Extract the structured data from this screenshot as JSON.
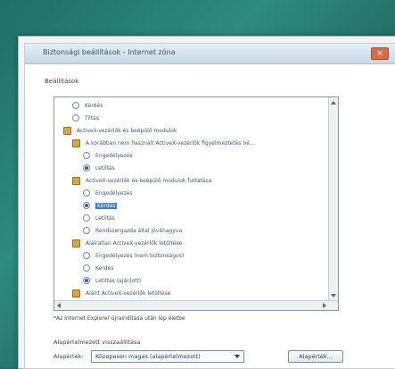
{
  "window": {
    "title": "Biztonsági beállítások - Internet zóna",
    "close_label": "×"
  },
  "settings_label": "Beállítások",
  "items": [
    {
      "type": "radio",
      "level": 2,
      "checked": false,
      "selected": false,
      "label": "Kérdés"
    },
    {
      "type": "radio",
      "level": 2,
      "checked": false,
      "selected": false,
      "label": "Tiltás"
    },
    {
      "type": "group",
      "level": 1,
      "label": "ActiveX-vezérlők és beépülő modulok"
    },
    {
      "type": "group",
      "level": 2,
      "label": "A korábban nem használt ActiveX-vezérlők figyelmeztetés né..."
    },
    {
      "type": "radio",
      "level": 3,
      "checked": false,
      "selected": false,
      "label": "Engedélyezés"
    },
    {
      "type": "radio",
      "level": 3,
      "checked": true,
      "selected": false,
      "label": "Letiltás"
    },
    {
      "type": "group",
      "level": 2,
      "label": "ActiveX-vezérlők és beépülő modulok futtatása"
    },
    {
      "type": "radio",
      "level": 3,
      "checked": false,
      "selected": false,
      "label": "Engedélyezés"
    },
    {
      "type": "radio",
      "level": 3,
      "checked": true,
      "selected": true,
      "label": "Kérdés"
    },
    {
      "type": "radio",
      "level": 3,
      "checked": false,
      "selected": false,
      "label": "Letiltás"
    },
    {
      "type": "radio",
      "level": 3,
      "checked": false,
      "selected": false,
      "label": "Rendszergazda által jóváhagyva"
    },
    {
      "type": "group",
      "level": 2,
      "label": "Aláíratlan ActiveX-vezérlők letöltése"
    },
    {
      "type": "radio",
      "level": 3,
      "checked": false,
      "selected": false,
      "label": "Engedélyezés (nem biztonságos)"
    },
    {
      "type": "radio",
      "level": 3,
      "checked": false,
      "selected": false,
      "label": "Kérdés"
    },
    {
      "type": "radio",
      "level": 3,
      "checked": true,
      "selected": false,
      "label": "Letiltás (ajánlott)"
    },
    {
      "type": "group",
      "level": 2,
      "label": "Aláírt ActiveX-vezérlők letöltése"
    }
  ],
  "note": "*Az Internet Explorer újraindítása után lép életbe",
  "reset": {
    "group_label": "Alapértelmezett visszaállítása",
    "row_label": "Alapérték:",
    "dropdown_value": "Közepesen magas (alapértelmezett)",
    "button_label": "Alapérték..."
  },
  "colors": {
    "desktop": "#2f8a7f",
    "selection": "#3c7fd8",
    "close_button": "#d96a4e"
  }
}
